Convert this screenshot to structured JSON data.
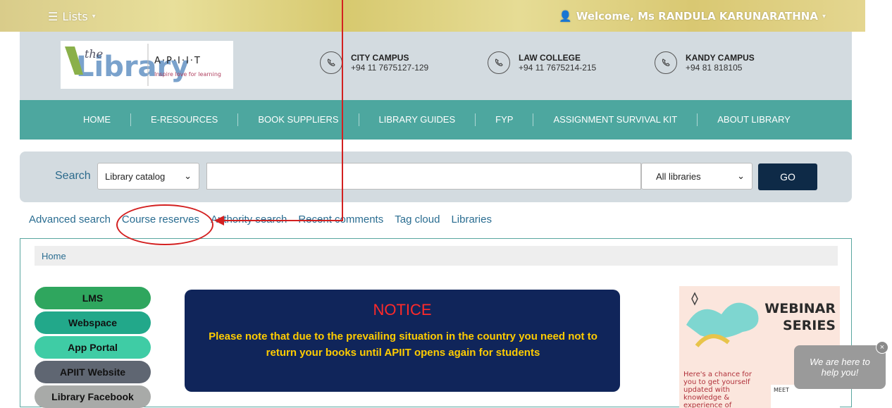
{
  "topbar": {
    "lists_label": "Lists",
    "welcome_text": "Welcome, Ms RANDULA KARUNARATHNA"
  },
  "logo": {
    "library_text": "Library",
    "the_text": "the",
    "apiit_text": "A·P·I·I·T",
    "tagline": "Inspire love for learning"
  },
  "contacts": [
    {
      "title": "CITY CAMPUS",
      "phone": "+94 11 7675127-129"
    },
    {
      "title": "LAW COLLEGE",
      "phone": "+94 11 7675214-215"
    },
    {
      "title": "KANDY CAMPUS",
      "phone": "+94 81 818105"
    }
  ],
  "nav": {
    "items": [
      "HOME",
      "E-RESOURCES",
      "BOOK SUPPLIERS",
      "LIBRARY GUIDES",
      "FYP",
      "ASSIGNMENT SURVIVAL KIT",
      "ABOUT LIBRARY"
    ]
  },
  "search": {
    "label": "Search",
    "catalog_select": "Library catalog",
    "input_value": "",
    "libraries_select": "All libraries",
    "go_label": "GO"
  },
  "links": [
    "Advanced search",
    "Course reserves",
    "Authority search",
    "Recent comments",
    "Tag cloud",
    "Libraries"
  ],
  "breadcrumb": "Home",
  "sidebar_buttons": [
    {
      "label": "LMS",
      "color": "#2fa65e"
    },
    {
      "label": "Webspace",
      "color": "#22a88a"
    },
    {
      "label": "App Portal",
      "color": "#3fcca5"
    },
    {
      "label": "APIIT Website",
      "color": "#5f6672"
    },
    {
      "label": "Library Facebook",
      "color": "#a8aaa8"
    }
  ],
  "notice": {
    "title": "NOTICE",
    "text": "Please note that due to the prevailing situation in the country you need not to return your books until APIIT opens again for students"
  },
  "webinar": {
    "title_line1": "WEBINAR",
    "title_line2": "SERIES",
    "text": "Here's a chance for you to get yourself updated with knowledge & experience of",
    "meet_label": "MEET"
  },
  "chat": {
    "line1": "We are here to",
    "line2": "help you!",
    "close": "×"
  },
  "colors": {
    "nav_bg": "#4da79f",
    "header_bg": "#d3dbe0",
    "go_bg": "#0e2a47",
    "link": "#2a6d91",
    "annotation": "#d32020",
    "notice_bg": "#10255a"
  }
}
